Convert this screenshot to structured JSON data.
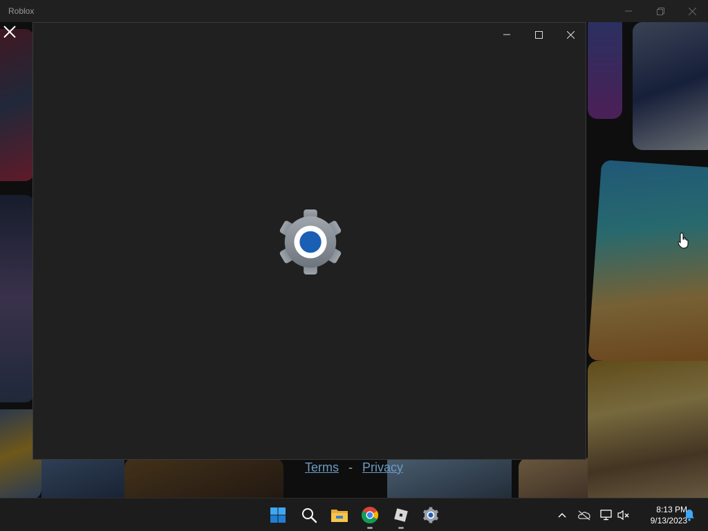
{
  "roblox_window": {
    "title": "Roblox"
  },
  "footer": {
    "terms": "Terms",
    "separator": "-",
    "privacy": "Privacy"
  },
  "settings_window": {
    "icon": "settings-gear-icon",
    "controls": [
      "minimize-icon",
      "maximize-icon",
      "close-icon"
    ]
  },
  "taskbar": {
    "apps": [
      {
        "name": "start",
        "icon": "windows-logo-icon"
      },
      {
        "name": "search",
        "icon": "search-icon"
      },
      {
        "name": "file-explorer",
        "icon": "folder-icon"
      },
      {
        "name": "chrome",
        "icon": "chrome-icon"
      },
      {
        "name": "roblox",
        "icon": "roblox-icon"
      },
      {
        "name": "settings",
        "icon": "settings-gear-icon"
      }
    ],
    "tray": [
      "chevron-up-icon",
      "onedrive-icon",
      "network-icon",
      "volume-muted-icon"
    ],
    "clock": {
      "time": "8:13 PM",
      "date": "9/13/2023"
    },
    "notification_icon": "bell-icon"
  },
  "colors": {
    "accent_blue": "#1a5fb4",
    "gear_gray": "#8a9098",
    "link_blue": "#6c9cc4"
  }
}
